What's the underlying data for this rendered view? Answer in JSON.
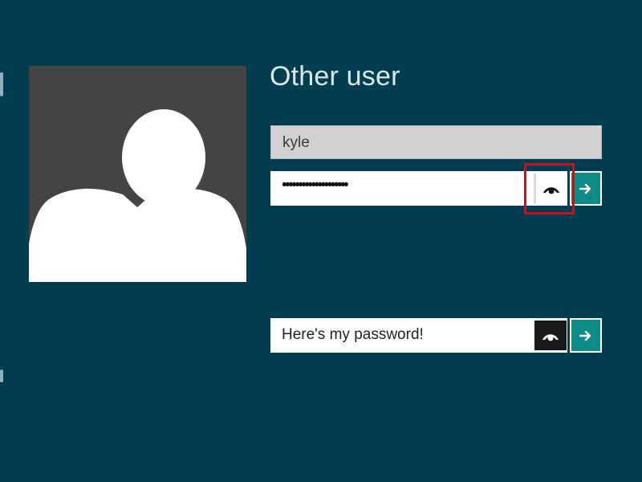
{
  "login": {
    "title": "Other user",
    "username_value": "kyle",
    "password_masked": "••••••••••••••••••••",
    "password_revealed": "Here's my password!"
  },
  "icons": {
    "avatar": "user-silhouette-icon",
    "reveal": "eye-icon",
    "submit": "arrow-right-icon"
  },
  "colors": {
    "background": "#033d51",
    "avatar_tile": "#444443",
    "submit_accent": "#0e8b86",
    "highlight": "#c0151b"
  }
}
